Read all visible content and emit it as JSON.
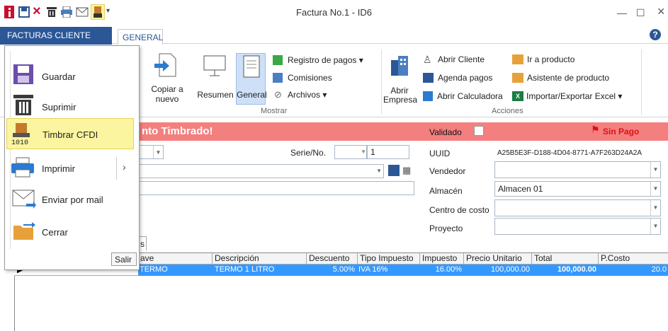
{
  "window": {
    "title": "Factura No.1 - ID6",
    "minimize": "—",
    "maximize": "☐",
    "close": "×"
  },
  "tabs": {
    "module": "FACTURAS CLIENTE",
    "general": "GENERAL",
    "help": "?"
  },
  "ribbon": {
    "copiar_line1": "Copiar a",
    "copiar_line2": "nuevo",
    "resumen": "Resumen",
    "general": "General",
    "registro_pagos": "Registro de pagos ▾",
    "comisiones": "Comisiones",
    "archivos": "Archivos ▾",
    "mostrar_group": "Mostrar",
    "abrir_empresa_line1": "Abrir",
    "abrir_empresa_line2": "Empresa",
    "abrir_cliente": "Abrir Cliente",
    "agenda_pagos": "Agenda pagos",
    "abrir_calculadora": "Abrir Calculadora",
    "ir_producto": "Ir a producto",
    "asistente_producto": "Asistente de producto",
    "importar_excel": "Importar/Exportar Excel ▾",
    "acciones_group": "Acciones"
  },
  "banner": {
    "text": "nto Timbrado!",
    "validado": "Validado",
    "sin_pago": "Sin Pago"
  },
  "form": {
    "serie_label": "Serie/No.",
    "serie_no": "1",
    "uuid_label": "UUID",
    "uuid_value": "A25B5E3F-D188-4D04-8771-A7F263D24A2A",
    "vendedor_label": "Vendedor",
    "almacen_label": "Almacén",
    "almacen_value": "Almacen 01",
    "centro_label": "Centro de costo",
    "proyecto_label": "Proyecto",
    "subtab": "s"
  },
  "grid": {
    "headers": [
      "ave",
      "Descripción",
      "Descuento",
      "Tipo Impuesto",
      "Impuesto",
      "Precio Unitario",
      "Total",
      "P.Costo"
    ],
    "row": [
      "TERMO",
      "TERMO 1 LITRO",
      "5.00%",
      "IVA 16%",
      "16.00%",
      "100,000.00",
      "100,000.00",
      "20.0"
    ],
    "row_indicator": "▶"
  },
  "menu": {
    "guardar": "Guardar",
    "suprimir": "Suprimir",
    "timbrar": "Timbrar CFDI",
    "imprimir": "Imprimir",
    "enviar": "Enviar por mail",
    "cerrar": "Cerrar",
    "salir": "Salir",
    "submenu_arrow": "›"
  },
  "colors": {
    "accent": "#2b5797",
    "banner": "#f47f7f",
    "selection": "#3399ff",
    "highlight": "#fbf5a0"
  }
}
